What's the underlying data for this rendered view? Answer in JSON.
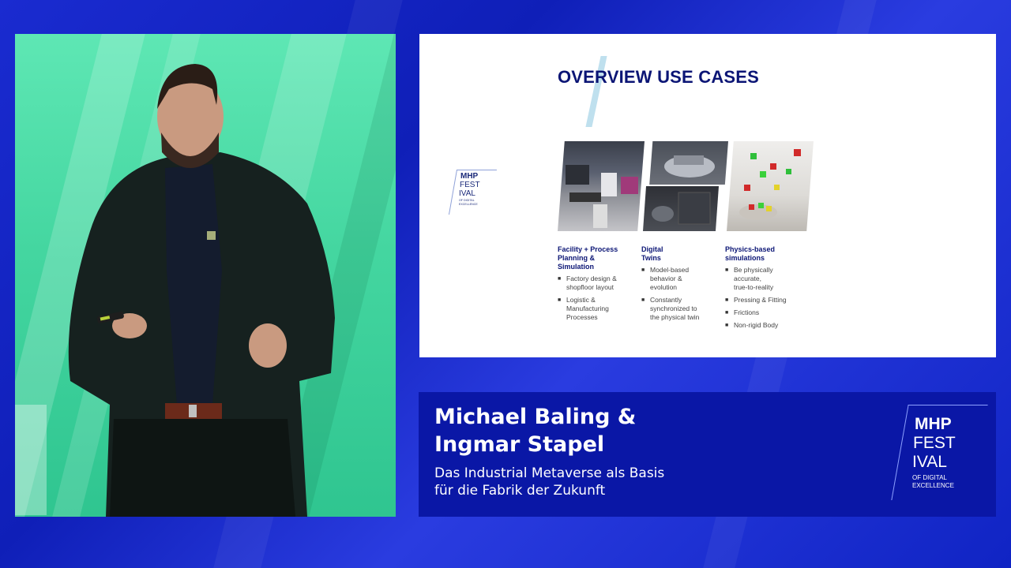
{
  "slide": {
    "title": "OVERVIEW USE CASES",
    "logo": {
      "line1": "MHP",
      "line2": "FEST",
      "line3": "IVAL",
      "line4": "OF DIGITAL",
      "line5": "EXCELLENCE"
    },
    "columns": [
      {
        "title_lines": [
          "Facility + Process",
          "Planning &",
          "Simulation"
        ],
        "items": [
          [
            "Factory design &",
            "shopfloor layout"
          ],
          [
            "Logistic &",
            "Manufacturing",
            "Processes"
          ]
        ]
      },
      {
        "title_lines": [
          "Digital",
          "Twins"
        ],
        "items": [
          [
            "Model-based",
            "behavior &",
            "evolution"
          ],
          [
            "Constantly",
            "synchronized to",
            "the physical twin"
          ]
        ]
      },
      {
        "title_lines": [
          "Physics-based",
          "simulations"
        ],
        "items": [
          [
            "Be physically",
            "accurate,",
            "true-to-reality"
          ],
          [
            "Pressing & Fitting"
          ],
          [
            "Frictions"
          ],
          [
            "Non-rigid Body"
          ]
        ]
      }
    ]
  },
  "caption": {
    "speakers_line1": "Michael Baling &",
    "speakers_line2": "Ingmar Stapel",
    "talk_line1": "Das Industrial Metaverse als Basis",
    "talk_line2": "für die Fabrik der Zukunft",
    "logo": {
      "line1": "MHP",
      "line2": "FEST",
      "line3": "IVAL",
      "line4": "OF DIGITAL",
      "line5": "EXCELLENCE"
    }
  },
  "colors": {
    "brand_blue": "#0a17a6",
    "slide_title": "#0b1575",
    "stage_green": "#44d6a0"
  },
  "icons": {
    "bullet": "■"
  }
}
